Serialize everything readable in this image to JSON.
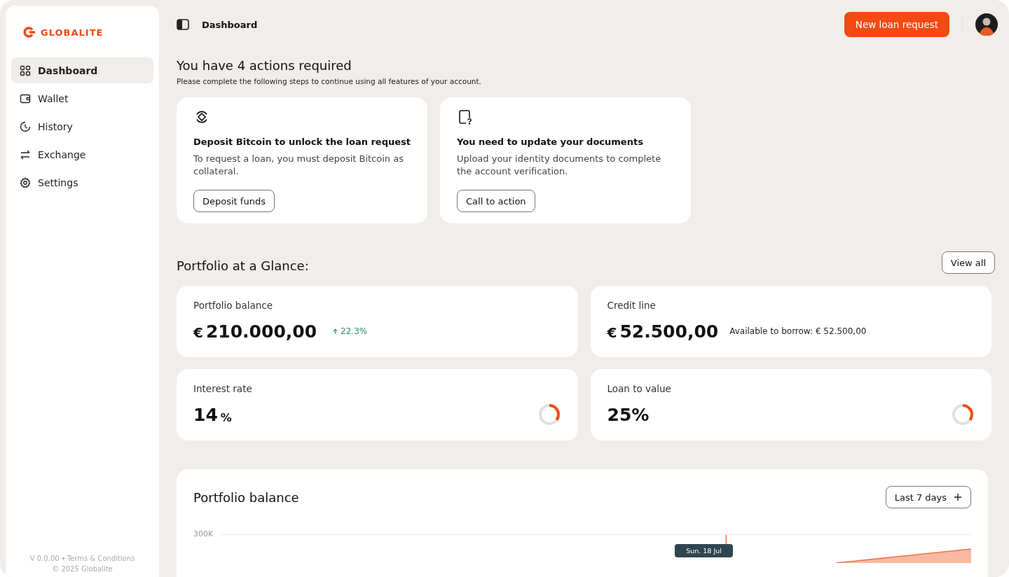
{
  "brand": {
    "name": "GLOBALITE"
  },
  "sidebar": {
    "items": [
      {
        "label": "Dashboard",
        "kind": "grid",
        "selected": true
      },
      {
        "label": "Wallet",
        "kind": "wallet",
        "selected": false
      },
      {
        "label": "History",
        "kind": "clock",
        "selected": false
      },
      {
        "label": "Exchange",
        "kind": "swap",
        "selected": false
      },
      {
        "label": "Settings",
        "kind": "gear",
        "selected": false
      }
    ],
    "footer": {
      "version": "V 0.0.00",
      "link": "Terms & Conditions",
      "copyright": "© 2025 Globalite"
    }
  },
  "header": {
    "title": "Dashboard",
    "primary_button": "New loan request"
  },
  "actions": {
    "title": "You have 4 actions required",
    "subtitle": "Please complete the following steps to continue using all features of your account.",
    "cards": [
      {
        "kind": "coin",
        "title": "Deposit Bitcoin to unlock the loan request",
        "text": "To request a loan, you must deposit Bitcoin as collateral.",
        "button": "Deposit funds"
      },
      {
        "kind": "document",
        "title": "You need to update your documents",
        "text": "Upload your identity documents to complete the account verification.",
        "button": "Call to action"
      }
    ]
  },
  "portfolio": {
    "title": "Portfolio at a Glance:",
    "button": "View all",
    "metrics": [
      {
        "label": "Portfolio balance",
        "currency": "€",
        "value": "210.000,00",
        "trend": "22.3%"
      },
      {
        "label": "Credit line",
        "currency": "€",
        "value": "52.500,00",
        "note": "Available to borrow: € 52.500,00"
      },
      {
        "label": "Interest rate",
        "value": "14",
        "unit": "%",
        "level": 0.35
      },
      {
        "label": "Loan to value",
        "value": "25%",
        "level": 0.35
      }
    ]
  },
  "chart_card": {
    "title": "Portfolio balance",
    "range_button": "Last 7 days",
    "y_tick": "300K",
    "tooltip": "Sun. 18 Jul"
  }
}
